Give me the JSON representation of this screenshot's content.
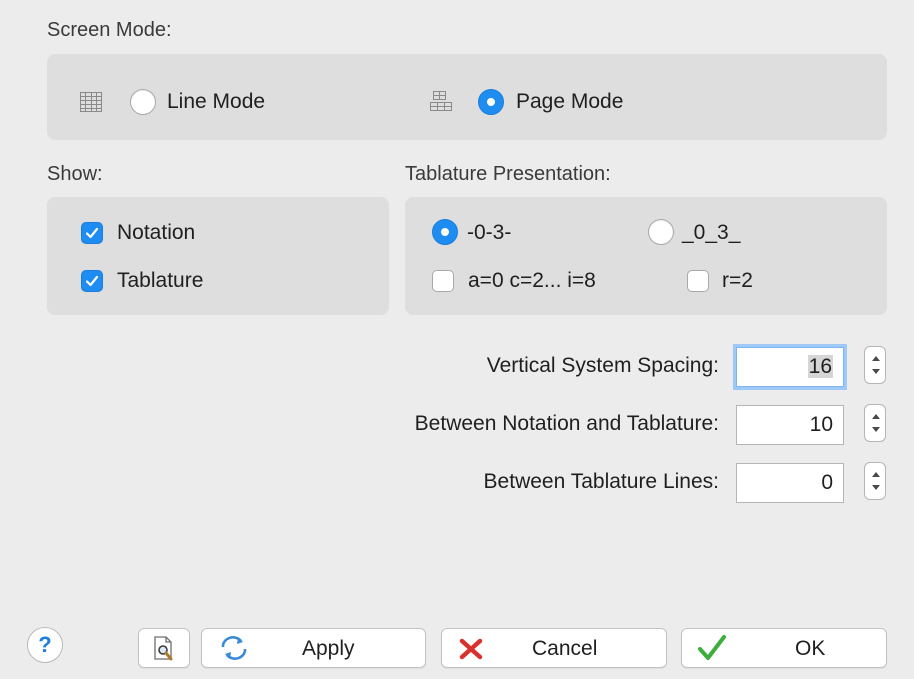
{
  "screen_mode": {
    "label": "Screen Mode:",
    "line_mode": {
      "label": "Line Mode",
      "selected": false,
      "icon": "line-mode-grid-icon"
    },
    "page_mode": {
      "label": "Page Mode",
      "selected": true,
      "icon": "page-mode-grid-icon"
    }
  },
  "show": {
    "label": "Show:",
    "notation": {
      "label": "Notation",
      "checked": true
    },
    "tablature": {
      "label": "Tablature",
      "checked": true
    }
  },
  "tablature_presentation": {
    "label": "Tablature Presentation:",
    "option_dash": {
      "label": "-0-3-",
      "selected": true
    },
    "option_underscore": {
      "label": "_0_3_",
      "selected": false
    },
    "letters": {
      "label": "a=0 c=2... i=8",
      "checked": false
    },
    "r2": {
      "label": "r=2",
      "checked": false
    }
  },
  "spacing": {
    "vertical_system": {
      "label": "Vertical System Spacing:",
      "value": "16"
    },
    "notation_tablature": {
      "label": "Between Notation and Tablature:",
      "value": "10"
    },
    "tablature_lines": {
      "label": "Between Tablature Lines:",
      "value": "0"
    }
  },
  "footer": {
    "help_label": "?",
    "preview_icon": "print-preview-icon",
    "apply_label": "Apply",
    "cancel_label": "Cancel",
    "ok_label": "OK"
  },
  "colors": {
    "accent": "#1e8cf0",
    "cancel_x": "#d8322e",
    "ok_check": "#3cae3c"
  }
}
